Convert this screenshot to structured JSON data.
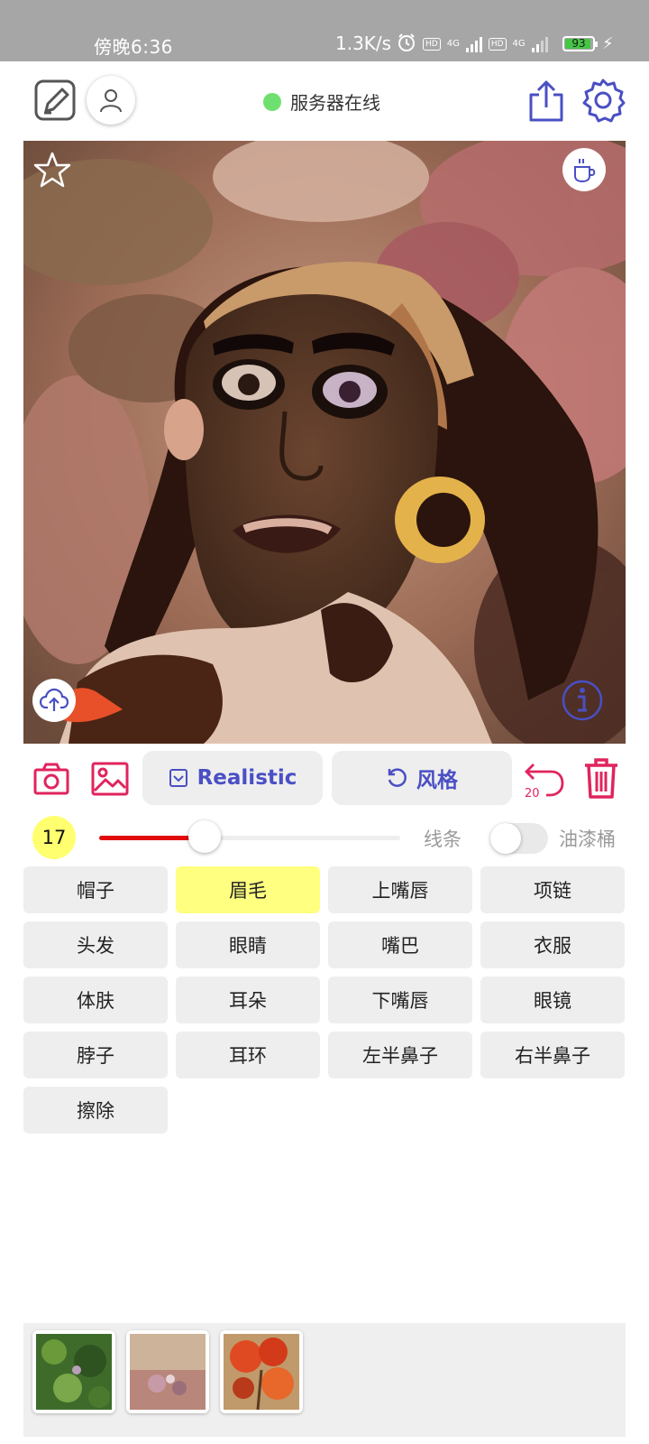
{
  "status_bar": {
    "time": "傍晚6:36",
    "net_speed": "1.3K/s",
    "hd_badge": "HD",
    "network_1": "4G",
    "network_2": "4G",
    "battery": "93"
  },
  "top_bar": {
    "server_status": "服务器在线",
    "server_status_color": "#6fe06f",
    "icon_color": "#4a4fc4"
  },
  "tools": {
    "model_button": "Realistic",
    "style_button": "风格",
    "undo_count": "20",
    "accent_color": "#e0245e"
  },
  "brush": {
    "size": "17",
    "size_level": 0.35,
    "line_label": "线条",
    "bucket_label": "油漆桶"
  },
  "parts": [
    {
      "label": "帽子",
      "selected": false
    },
    {
      "label": "眉毛",
      "selected": true
    },
    {
      "label": "上嘴唇",
      "selected": false
    },
    {
      "label": "项链",
      "selected": false
    },
    {
      "label": "头发",
      "selected": false
    },
    {
      "label": "眼睛",
      "selected": false
    },
    {
      "label": "嘴巴",
      "selected": false
    },
    {
      "label": "衣服",
      "selected": false
    },
    {
      "label": "体肤",
      "selected": false
    },
    {
      "label": "耳朵",
      "selected": false
    },
    {
      "label": "下嘴唇",
      "selected": false
    },
    {
      "label": "眼镜",
      "selected": false
    },
    {
      "label": "脖子",
      "selected": false
    },
    {
      "label": "耳环",
      "selected": false
    },
    {
      "label": "左半鼻子",
      "selected": false
    },
    {
      "label": "右半鼻子",
      "selected": false
    },
    {
      "label": "擦除",
      "selected": false
    }
  ],
  "style_thumbnails": [
    "green-foliage",
    "pink-floral-texture",
    "red-flowers"
  ]
}
